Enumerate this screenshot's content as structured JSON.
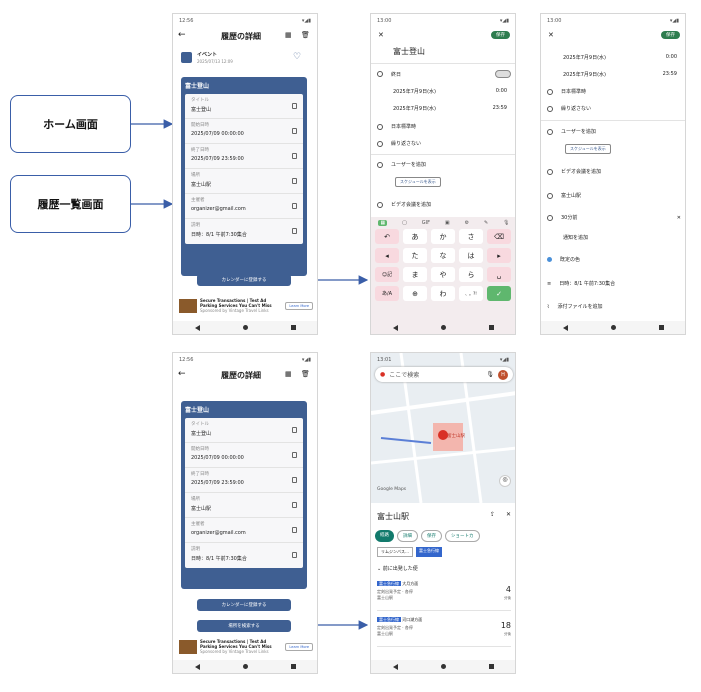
{
  "callouts": {
    "home": "ホーム画面",
    "history_list": "履歴一覧画面"
  },
  "status": {
    "time1": "12:56",
    "time2": "13:00",
    "time3": "13:00",
    "time4": "12:56",
    "time5": "13:01"
  },
  "detail": {
    "title": "履歴の詳細",
    "event_label": "イベント",
    "event_date": "2025/07/13 12:09",
    "card_title": "富士登山",
    "fields": [
      {
        "label": "タイトル",
        "value": "富士登山"
      },
      {
        "label": "開始日時",
        "value": "2025/07/09 00:00:00"
      },
      {
        "label": "終了日時",
        "value": "2025/07/09 23:59:00"
      },
      {
        "label": "場所",
        "value": "富士山駅"
      },
      {
        "label": "主催者",
        "value": "organizer@gmail.com"
      },
      {
        "label": "説明",
        "value": "日時：8/1 午前7:30集合"
      }
    ],
    "register_button": "カレンダーに登録する",
    "search_place_button": "場所を検索する",
    "ad_title": "Secure Transactions | Test Ad",
    "ad_line2": "Parking Services You Can't Miss",
    "ad_line3": "Sponsored by Vintage Travel Links",
    "ad_badge": "テスト広告",
    "ad_learn": "Learn More"
  },
  "calendar_edit": {
    "save": "保存",
    "title": "富士登山",
    "allday": "終日",
    "start_date": "2025年7月9日(水)",
    "start_time": "0:00",
    "end_date": "2025年7月9日(水)",
    "end_time": "23:59",
    "timezone": "日本標準時",
    "repeat": "繰り返さない",
    "add_user": "ユーザーを追加",
    "show_schedule": "スケジュールを表示",
    "video": "ビデオ会議を追加",
    "location": "富士山駅",
    "notify_time": "30分前",
    "add_notify": "通知を追加",
    "default_color": "既定の色",
    "description": "日時：8/1 午前7:30集合",
    "attachment": "添付ファイルを追加"
  },
  "keyboard": {
    "gif": "GIF",
    "row1": [
      "あ",
      "か",
      "さ"
    ],
    "row2": [
      "た",
      "な",
      "は"
    ],
    "row3": [
      "ま",
      "や",
      "ら"
    ],
    "row4": [
      "わ",
      "、。?!"
    ],
    "emoji": "☺記",
    "kana": "あ",
    "lang": "あ/A"
  },
  "maps": {
    "search_placeholder": "ここで検索",
    "avatar": "H",
    "place": "富士山駅",
    "map_label": "富士山駅",
    "google": "Google Maps",
    "chips": [
      "経路",
      "詳細",
      "保存",
      "ショートカ"
    ],
    "tags": [
      "リムジンバス…",
      "富士急行線"
    ],
    "section": "前に出発した便",
    "trips": [
      {
        "line": "富士急行線",
        "dest": "大月方面",
        "info1": "定刻出発予定 · 各停",
        "info2": "富士山駅",
        "min": "4",
        "unit": "分後"
      },
      {
        "line": "富士急行線",
        "dest": "河口湖方面",
        "info1": "定刻出発予定 · 各停",
        "info2": "富士山駅",
        "min": "18",
        "unit": "分後"
      }
    ]
  }
}
